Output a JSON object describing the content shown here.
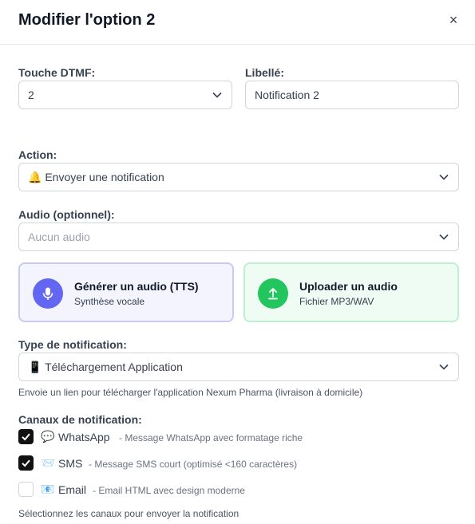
{
  "modal": {
    "title": "Modifier l'option 2",
    "close_glyph": "×"
  },
  "dtmf": {
    "label": "Touche DTMF:",
    "value": "2"
  },
  "libelle": {
    "label": "Libellé:",
    "value": "Notification 2"
  },
  "action": {
    "label": "Action:",
    "icon": "🔔",
    "value": "Envoyer une notification"
  },
  "audio": {
    "label": "Audio (optionnel):",
    "placeholder": "Aucun audio",
    "tts": {
      "title": "Générer un audio (TTS)",
      "subtitle": "Synthèse vocale",
      "icon": "microphone-icon",
      "color": "#6366f1"
    },
    "upload": {
      "title": "Uploader un audio",
      "subtitle": "Fichier MP3/WAV",
      "icon": "upload-arrow-icon",
      "color": "#22c55e"
    }
  },
  "notification_type": {
    "label": "Type de notification:",
    "icon": "📱",
    "value": "Téléchargement Application",
    "help": "Envoie un lien pour télécharger l'application Nexum Pharma (livraison à domicile)"
  },
  "channels": {
    "label": "Canaux de notification:",
    "items": [
      {
        "icon": "💬",
        "name": "WhatsApp",
        "description": "- Message WhatsApp avec formatage riche",
        "checked": true
      },
      {
        "icon": "📨",
        "name": "SMS",
        "description": "- Message SMS court (optimisé <160 caractères)",
        "checked": true
      },
      {
        "icon": "📧",
        "name": "Email",
        "description": "- Email HTML avec design moderne",
        "checked": false
      }
    ],
    "help": "Sélectionnez les canaux pour envoyer la notification"
  }
}
